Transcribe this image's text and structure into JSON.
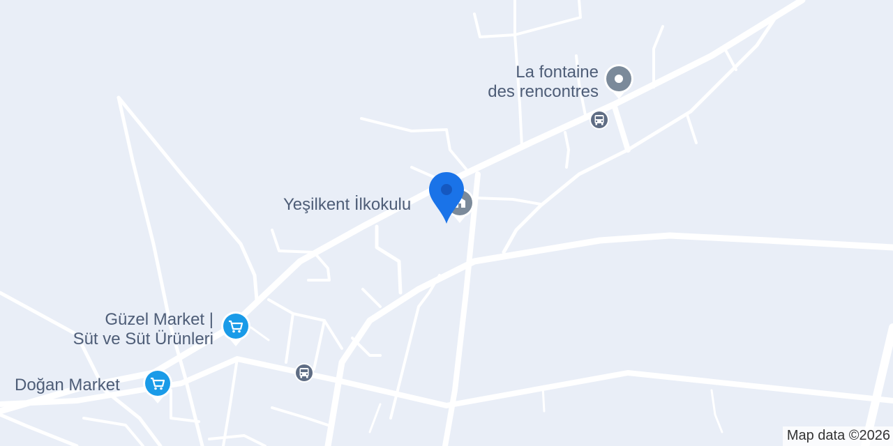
{
  "map": {
    "background": "#e9eef7",
    "road_color": "#ffffff"
  },
  "pois": {
    "fountain": {
      "lines": [
        "La fontaine",
        "des rencontres"
      ],
      "icon": "map-pin-icon",
      "color": "#7b8a9a"
    },
    "school": {
      "label": "Yeşilkent İlkokulu",
      "icon": "school-icon",
      "color": "#7b8a9a"
    },
    "guzel_market": {
      "lines": [
        "Güzel Market |",
        "Süt ve Süt Ürünleri"
      ],
      "icon": "shopping-cart-icon",
      "color": "#1a9be8"
    },
    "dogan_market": {
      "label": "Doğan Market",
      "icon": "shopping-cart-icon",
      "color": "#1a9be8"
    }
  },
  "transit": [
    {
      "icon": "bus-icon"
    },
    {
      "icon": "bus-icon"
    }
  ],
  "marker": {
    "icon": "location-marker-icon",
    "color": "#1a73e8"
  },
  "attribution": "Map data ©2026"
}
